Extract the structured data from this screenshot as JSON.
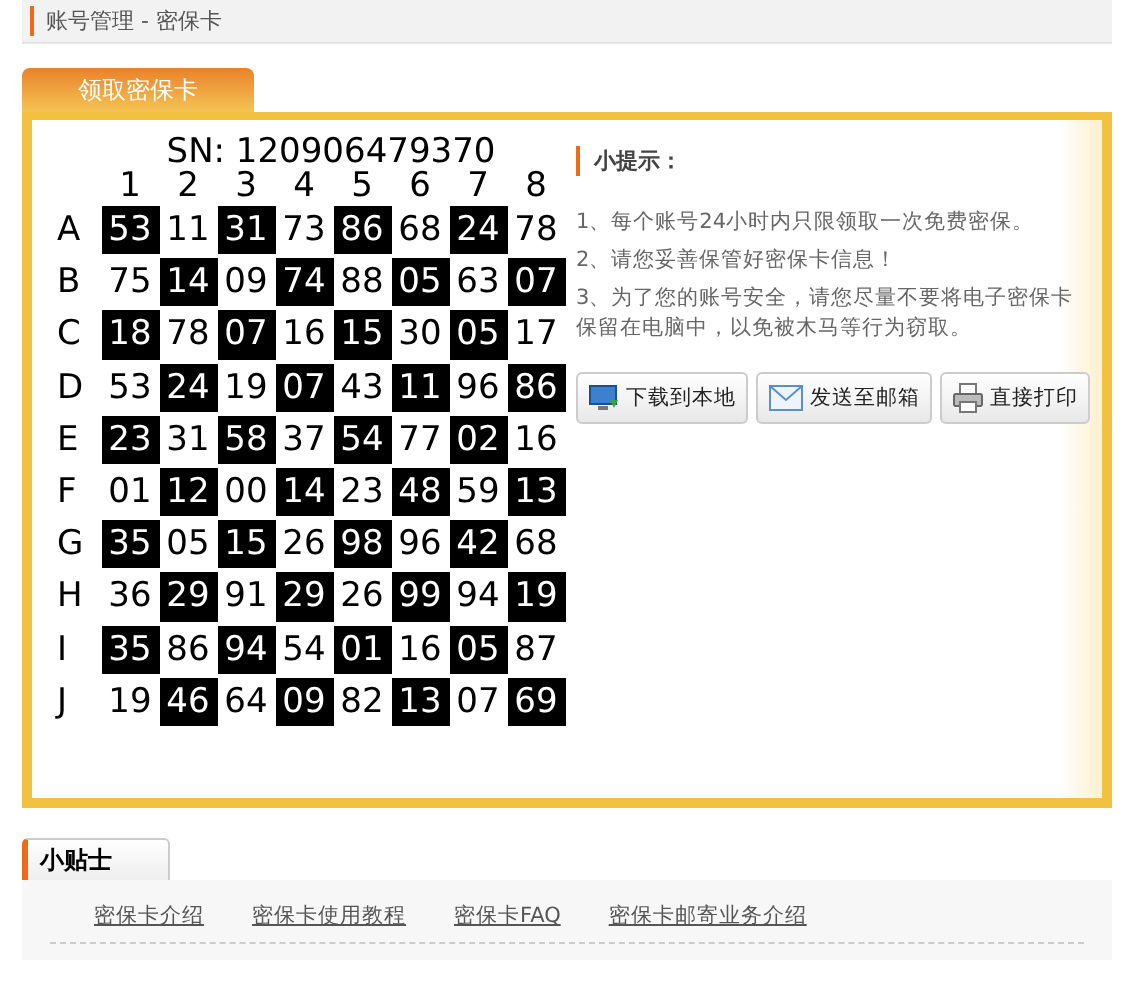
{
  "breadcrumb": "账号管理 - 密保卡",
  "tab": {
    "label": "领取密保卡",
    "selected": true
  },
  "card": {
    "serial": "SN: 120906479370",
    "columns": [
      "1",
      "2",
      "3",
      "4",
      "5",
      "6",
      "7",
      "8"
    ],
    "rows": [
      {
        "label": "A",
        "values": [
          "53",
          "11",
          "31",
          "73",
          "86",
          "68",
          "24",
          "78"
        ]
      },
      {
        "label": "B",
        "values": [
          "75",
          "14",
          "09",
          "74",
          "88",
          "05",
          "63",
          "07"
        ]
      },
      {
        "label": "C",
        "values": [
          "18",
          "78",
          "07",
          "16",
          "15",
          "30",
          "05",
          "17"
        ]
      },
      {
        "label": "D",
        "values": [
          "53",
          "24",
          "19",
          "07",
          "43",
          "11",
          "96",
          "86"
        ]
      },
      {
        "label": "E",
        "values": [
          "23",
          "31",
          "58",
          "37",
          "54",
          "77",
          "02",
          "16"
        ]
      },
      {
        "label": "F",
        "values": [
          "01",
          "12",
          "00",
          "14",
          "23",
          "48",
          "59",
          "13"
        ]
      },
      {
        "label": "G",
        "values": [
          "35",
          "05",
          "15",
          "26",
          "98",
          "96",
          "42",
          "68"
        ]
      },
      {
        "label": "H",
        "values": [
          "36",
          "29",
          "91",
          "29",
          "26",
          "99",
          "94",
          "19"
        ]
      },
      {
        "label": "I",
        "values": [
          "35",
          "86",
          "94",
          "54",
          "01",
          "16",
          "05",
          "87"
        ]
      },
      {
        "label": "J",
        "values": [
          "19",
          "46",
          "64",
          "09",
          "82",
          "13",
          "07",
          "69"
        ]
      }
    ]
  },
  "tips": {
    "title": "小提示：",
    "items": [
      "1、每个账号24小时内只限领取一次免费密保。",
      "2、请您妥善保管好密保卡信息！",
      "3、为了您的账号安全，请您尽量不要将电子密保卡保留在电脑中，以免被木马等行为窃取。"
    ],
    "buttons": [
      {
        "kind": "download",
        "label": "下载到本地"
      },
      {
        "kind": "mail",
        "label": "发送至邮箱"
      },
      {
        "kind": "print",
        "label": "直接打印"
      }
    ]
  },
  "footer": {
    "tab": "小贴士",
    "links": [
      "密保卡介绍",
      "密保卡使用教程",
      "密保卡FAQ",
      "密保卡邮寄业务介绍"
    ]
  }
}
